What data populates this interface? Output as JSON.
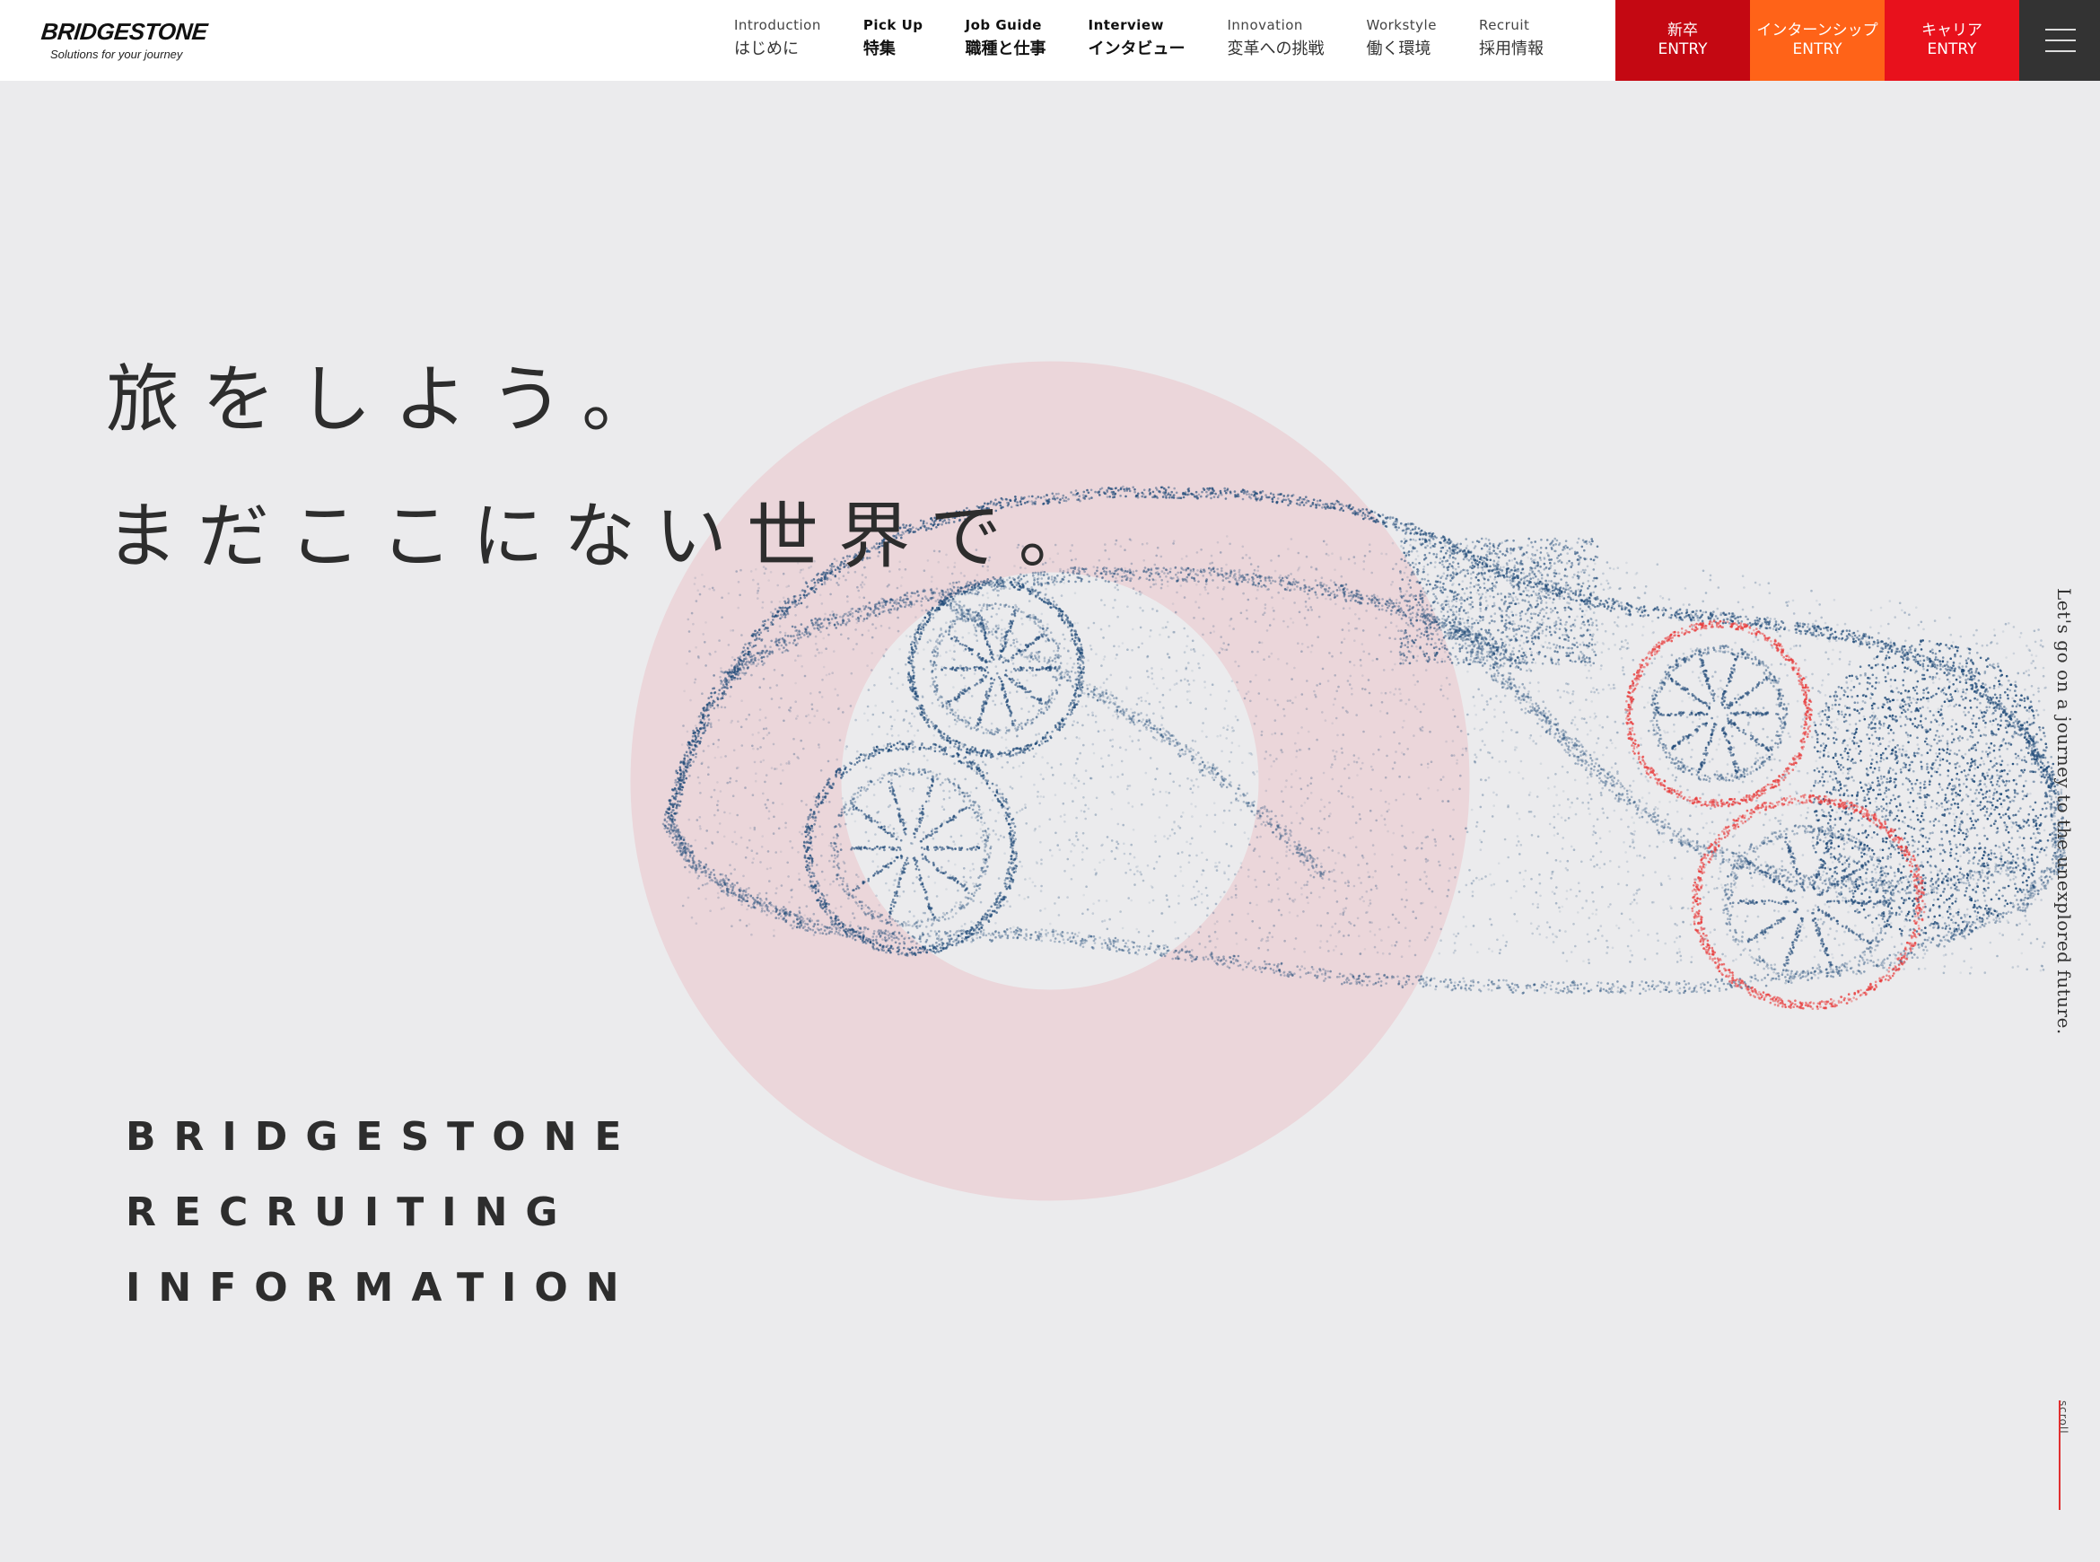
{
  "header": {
    "logo": {
      "wordmark": "BRIDGESTONE",
      "tagline": "Solutions for your journey"
    },
    "nav": [
      {
        "en": "Introduction",
        "jp": "はじめに"
      },
      {
        "en": "Pick Up",
        "jp": "特集"
      },
      {
        "en": "Job Guide",
        "jp": "職種と仕事"
      },
      {
        "en": "Interview",
        "jp": "インタビュー"
      },
      {
        "en": "Innovation",
        "jp": "変革への挑戦"
      },
      {
        "en": "Workstyle",
        "jp": "働く環境"
      },
      {
        "en": "Recruit",
        "jp": "採用情報"
      }
    ],
    "entry_buttons": [
      {
        "top": "新卒",
        "bottom": "ENTRY",
        "color": "#c40812"
      },
      {
        "top": "インターンシップ",
        "bottom": "ENTRY",
        "color": "#ff6318"
      },
      {
        "top": "キャリア",
        "bottom": "ENTRY",
        "color": "#e8111c"
      }
    ],
    "menu_icon": "hamburger-icon"
  },
  "hero": {
    "catch_line_1": "旅をしよう。",
    "catch_line_2": "まだここにない世界で。",
    "recruit_lines": [
      "BRIDGESTONE",
      "RECRUITING",
      "INFORMATION"
    ],
    "vertical_tagline": "Let's go on a journey to the unexplored future.",
    "scroll_label": "scroll",
    "colors": {
      "background": "#ebebed",
      "ring": "#ebd6da",
      "car_points": "#1f4a78",
      "tire_highlight": "#e83a3a",
      "accent_red": "#e03030"
    }
  }
}
